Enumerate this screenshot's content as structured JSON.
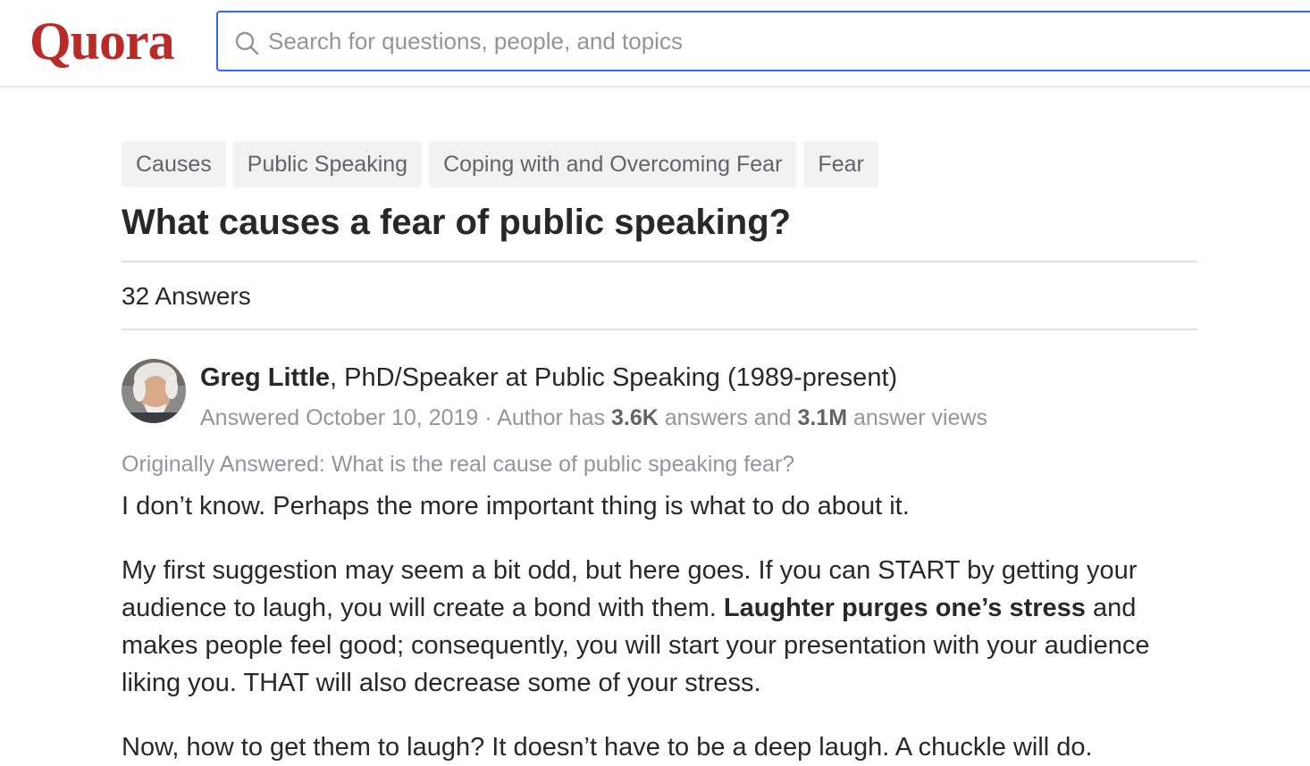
{
  "header": {
    "logo": "Quora",
    "search": {
      "placeholder": "Search for questions, people, and topics"
    }
  },
  "question": {
    "topics": [
      "Causes",
      "Public Speaking",
      "Coping with and Overcoming Fear",
      "Fear"
    ],
    "title": "What causes a fear of public speaking?",
    "answers_count": "32 Answers"
  },
  "answer": {
    "author_name": "Greg Little",
    "author_credential": ", PhD/Speaker at Public Speaking (1989-present)",
    "meta": {
      "answered": "Answered October 10, 2019 · Author has ",
      "answers_total": "3.6K",
      "mid": " answers and ",
      "views_total": "3.1M",
      "end": " answer views"
    },
    "originally_answered": "Originally Answered: What is the real cause of public speaking fear?",
    "paragraph_1": "I don’t know. Perhaps the more important thing is what to do about it.",
    "paragraph_2": {
      "part_1": "My first suggestion may seem a bit odd, but here goes. If you can START by getting your audience to laugh, you will create a bond with them. ",
      "bold": "Laughter purges one’s stress",
      "part_2": " and makes people feel good; consequently, you will start your presentation with your audience liking you. THAT will also decrease some of your stress."
    },
    "paragraph_3": "Now, how to get them to laugh? It doesn’t have to be a deep laugh. A chuckle will do."
  },
  "colors": {
    "brand": "#b92b27",
    "search_border": "#2e69ff",
    "topic_bg": "#f1f2f2",
    "muted_text": "#939598"
  }
}
